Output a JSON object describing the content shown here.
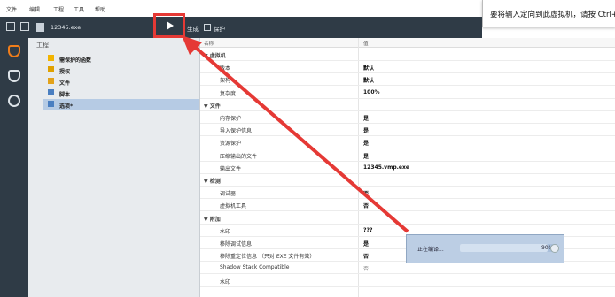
{
  "menu": [
    "文件",
    "编辑",
    "工程",
    "工具",
    "帮助"
  ],
  "tooltip": "要将输入定向到此虚拟机，请按 Ctrl+",
  "toolbar": {
    "file_name": "12345.exe",
    "run_label": "生成",
    "protect_label": "保护"
  },
  "tree": {
    "header": "工程",
    "items": [
      {
        "label": "需保护的函数",
        "icon": "star-icon",
        "color": "#f2b400"
      },
      {
        "label": "授权",
        "icon": "key-icon",
        "color": "#e0a100"
      },
      {
        "label": "文件",
        "icon": "file-icon",
        "color": "#e3a21a"
      },
      {
        "label": "脚本",
        "icon": "script-icon",
        "color": "#4a7fc1"
      },
      {
        "label": "选项*",
        "icon": "gear-icon",
        "color": "#4a7fc1",
        "selected": true
      }
    ]
  },
  "props": {
    "columns": {
      "name": "名称",
      "value": "值"
    },
    "rows": [
      {
        "type": "section",
        "label": "▼ 虚拟机"
      },
      {
        "type": "prop",
        "label": "版本",
        "value": "默认"
      },
      {
        "type": "prop",
        "label": "架构",
        "value": "默认"
      },
      {
        "type": "prop",
        "label": "复杂度",
        "value": "100%"
      },
      {
        "type": "section",
        "label": "▼ 文件"
      },
      {
        "type": "prop",
        "label": "内存保护",
        "value": "是"
      },
      {
        "type": "prop",
        "label": "导入保护信息",
        "value": "是"
      },
      {
        "type": "prop",
        "label": "资源保护",
        "value": "是"
      },
      {
        "type": "prop",
        "label": "压缩输出的文件",
        "value": "是"
      },
      {
        "type": "prop",
        "label": "输出文件",
        "value": "12345.vmp.exe"
      },
      {
        "type": "section",
        "label": "▼ 检测"
      },
      {
        "type": "prop",
        "label": "调试器",
        "value": "否"
      },
      {
        "type": "prop",
        "label": "虚拟机工具",
        "value": "否"
      },
      {
        "type": "section",
        "label": "▼ 附加"
      },
      {
        "type": "prop",
        "label": "水印",
        "value": "???"
      },
      {
        "type": "prop",
        "label": "移除调试信息",
        "value": "是"
      },
      {
        "type": "prop",
        "label": "移除重定位信息 （只对 EXE 文件有效）",
        "value": "否"
      },
      {
        "type": "prop",
        "label": "Shadow Stack Compatible",
        "value": "否",
        "dim": true
      },
      {
        "type": "prop",
        "label": "水印",
        "value": ""
      }
    ]
  },
  "progress": {
    "label": "正在编译...",
    "percent": 90,
    "percent_text": "90%"
  },
  "colors": {
    "dark": "#2f3b46",
    "highlight": "#e53935",
    "selection": "#b6cbe4"
  }
}
